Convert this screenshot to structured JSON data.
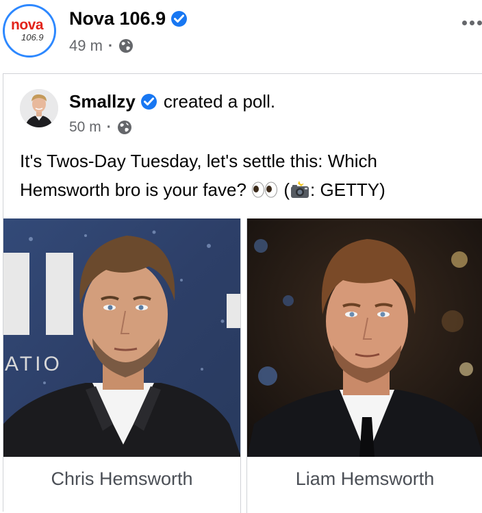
{
  "page": {
    "name": "Nova 106.9",
    "logo_word": "nova",
    "logo_freq": "106.9",
    "time": "49 m",
    "separator": "·"
  },
  "shared_post": {
    "author": "Smallzy",
    "action": "created a poll.",
    "time": "50 m",
    "separator": "·",
    "text_before_emoji": "It's Twos-Day Tuesday, let's settle this: Which Hemsworth bro is your fave? ",
    "text_credit_open": " (",
    "text_credit_close": ": GETTY)"
  },
  "poll": {
    "options": [
      {
        "label": "Chris Hemsworth"
      },
      {
        "label": "Liam Hemsworth"
      }
    ]
  },
  "colors": {
    "verified": "#1877f2",
    "nova_red": "#e2231a",
    "avatar_ring": "#2d88ff",
    "meta_text": "#65676b"
  },
  "icons": [
    "verified-badge-icon",
    "globe-icon",
    "more-options-icon",
    "eyes-emoji-icon",
    "camera-flash-emoji-icon"
  ]
}
